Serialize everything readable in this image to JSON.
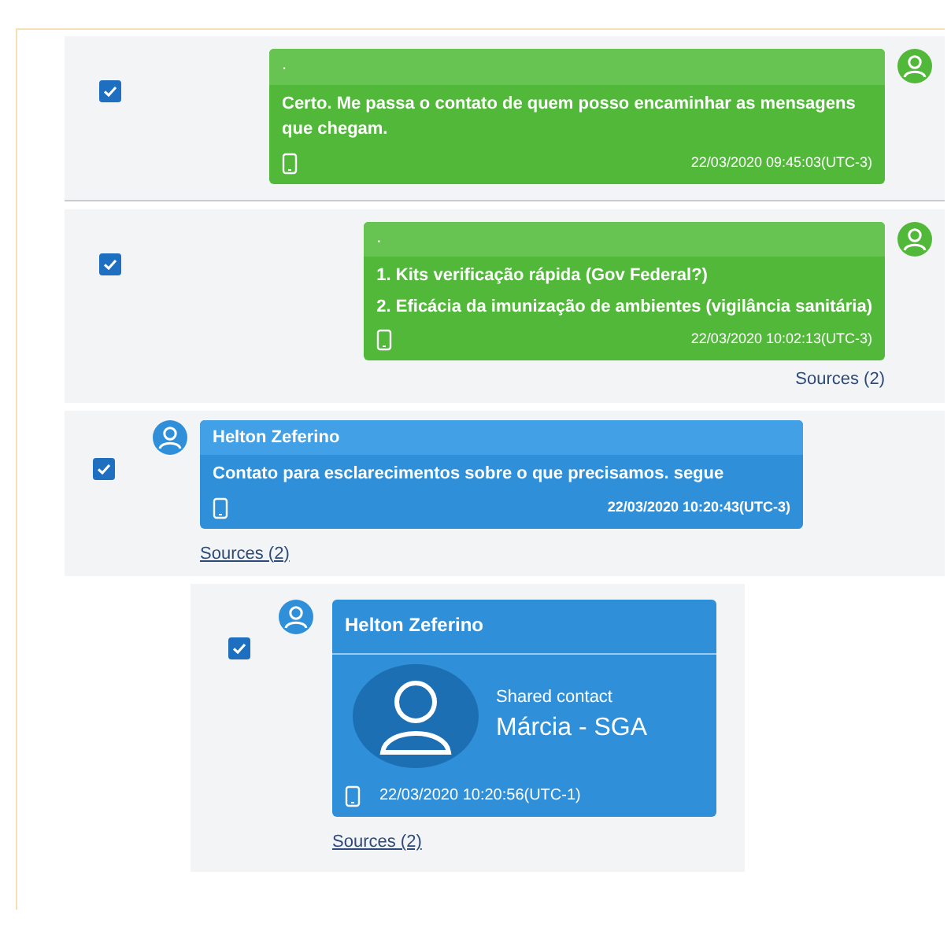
{
  "messages": [
    {
      "kind": "outgoing",
      "checked": true,
      "header": ".",
      "lines": [
        "Certo. Me passa o contato de quem posso encaminhar as mensagens que chegam."
      ],
      "timestamp": "22/03/2020 09:45:03(UTC-3)"
    },
    {
      "kind": "outgoing",
      "checked": true,
      "header": ".",
      "lines": [
        "1. Kits verificação rápida (Gov Federal?)",
        "2. Eficácia da imunização de ambientes (vigilância sanitária)"
      ],
      "timestamp": "22/03/2020 10:02:13(UTC-3)",
      "sources": "Sources (2)"
    },
    {
      "kind": "incoming",
      "checked": true,
      "header": "Helton Zeferino",
      "lines": [
        "Contato para esclarecimentos sobre o que precisamos. segue"
      ],
      "timestamp": "22/03/2020 10:20:43(UTC-3)",
      "sources": "Sources (2)"
    },
    {
      "kind": "contact",
      "checked": true,
      "header": "Helton Zeferino",
      "contact_label": "Shared contact",
      "contact_name": "Márcia - SGA",
      "timestamp": "22/03/2020 10:20:56(UTC-1)",
      "sources": "Sources (2)"
    }
  ]
}
